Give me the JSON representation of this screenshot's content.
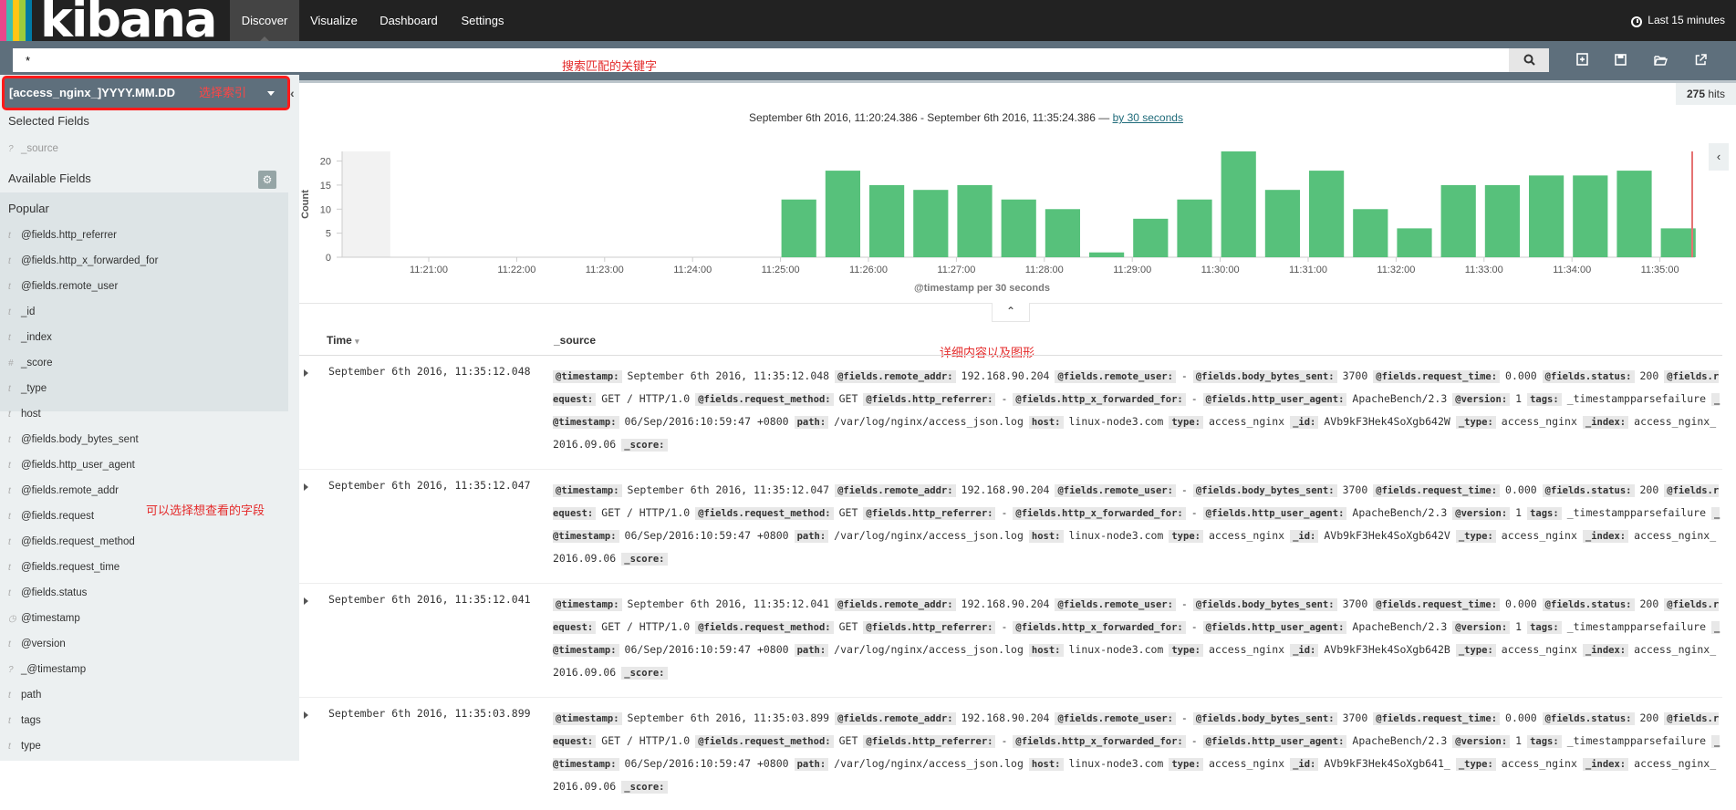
{
  "nav": {
    "logo": "kibana",
    "logo_colors": [
      "#e8478b",
      "#3ebeb0",
      "#fec514",
      "#9ccc3c",
      "#0079a5"
    ],
    "tabs": [
      {
        "label": "Discover",
        "active": true
      },
      {
        "label": "Visualize",
        "active": false
      },
      {
        "label": "Dashboard",
        "active": false
      },
      {
        "label": "Settings",
        "active": false
      }
    ],
    "timepicker": "Last 15 minutes"
  },
  "search": {
    "value": "*",
    "annotation": "搜索匹配的关键字"
  },
  "sidebar": {
    "index_pattern": "[access_nginx_]YYYY.MM.DD",
    "index_annotation": "选择索引",
    "selected_title": "Selected Fields",
    "selected_fields": [
      {
        "type": "?",
        "name": "_source"
      }
    ],
    "available_title": "Available Fields",
    "popular_title": "Popular",
    "popular_fields": [
      {
        "type": "t",
        "name": "@fields.http_referrer"
      },
      {
        "type": "t",
        "name": "@fields.http_x_forwarded_for"
      },
      {
        "type": "t",
        "name": "@fields.remote_user"
      },
      {
        "type": "t",
        "name": "_id"
      },
      {
        "type": "t",
        "name": "_index"
      },
      {
        "type": "#",
        "name": "_score"
      },
      {
        "type": "t",
        "name": "_type"
      },
      {
        "type": "t",
        "name": "host"
      }
    ],
    "other_fields": [
      {
        "type": "t",
        "name": "@fields.body_bytes_sent"
      },
      {
        "type": "t",
        "name": "@fields.http_user_agent"
      },
      {
        "type": "t",
        "name": "@fields.remote_addr"
      },
      {
        "type": "t",
        "name": "@fields.request"
      },
      {
        "type": "t",
        "name": "@fields.request_method"
      },
      {
        "type": "t",
        "name": "@fields.request_time"
      },
      {
        "type": "t",
        "name": "@fields.status"
      },
      {
        "type": "◷",
        "name": "@timestamp"
      },
      {
        "type": "t",
        "name": "@version"
      },
      {
        "type": "?",
        "name": "_@timestamp"
      },
      {
        "type": "t",
        "name": "path"
      },
      {
        "type": "t",
        "name": "tags"
      },
      {
        "type": "t",
        "name": "type"
      }
    ],
    "fields_annotation": "可以选择想查看的字段"
  },
  "hits": {
    "count": "275",
    "label": "hits"
  },
  "time_range": {
    "text": "September 6th 2016, 11:20:24.386 - September 6th 2016, 11:35:24.386 —",
    "interval": "by 30 seconds"
  },
  "chart_data": {
    "type": "bar",
    "ylabel": "Count",
    "xlabel": "@timestamp per 30 seconds",
    "ylim": [
      0,
      22
    ],
    "yticks": [
      0,
      5,
      10,
      15,
      20
    ],
    "xticks": [
      "11:21:00",
      "11:22:00",
      "11:23:00",
      "11:24:00",
      "11:25:00",
      "11:26:00",
      "11:27:00",
      "11:28:00",
      "11:29:00",
      "11:30:00",
      "11:31:00",
      "11:32:00",
      "11:33:00",
      "11:34:00",
      "11:35:00"
    ],
    "categories": [
      "11:25:00",
      "11:25:30",
      "11:26:00",
      "11:26:30",
      "11:27:00",
      "11:27:30",
      "11:28:00",
      "11:28:30",
      "11:29:00",
      "11:29:30",
      "11:30:00",
      "11:30:30",
      "11:31:00",
      "11:31:30",
      "11:32:00",
      "11:32:30",
      "11:33:00",
      "11:33:30",
      "11:34:00",
      "11:34:30",
      "11:35:00"
    ],
    "values": [
      12,
      18,
      15,
      14,
      15,
      12,
      10,
      1,
      8,
      12,
      22,
      14,
      18,
      10,
      6,
      15,
      15,
      17,
      17,
      18,
      6
    ],
    "bar_color": "#57c17b"
  },
  "table": {
    "time_header": "Time",
    "source_header": "_source",
    "annotation": "详细内容以及图形",
    "rows": [
      {
        "time": "September 6th 2016, 11:35:12.048",
        "fields": [
          {
            "k": "@timestamp:",
            "v": "September 6th 2016, 11:35:12.048"
          },
          {
            "k": "@fields.remote_addr:",
            "v": "192.168.90.204"
          },
          {
            "k": "@fields.remote_user:",
            "v": "-"
          },
          {
            "k": "@fields.body_bytes_sent:",
            "v": "3700"
          },
          {
            "k": "@fields.request_time:",
            "v": "0.000"
          },
          {
            "k": "@fields.status:",
            "v": "200"
          },
          {
            "k": "@fields.request:",
            "v": "GET / HTTP/1.0"
          },
          {
            "k": "@fields.request_method:",
            "v": "GET"
          },
          {
            "k": "@fields.http_referrer:",
            "v": "-"
          },
          {
            "k": "@fields.http_x_forwarded_for:",
            "v": "-"
          },
          {
            "k": "@fields.http_user_agent:",
            "v": "ApacheBench/2.3"
          },
          {
            "k": "@version:",
            "v": "1"
          },
          {
            "k": "tags:",
            "v": "_timestampparsefailure"
          },
          {
            "k": "_@timestamp:",
            "v": "06/Sep/2016:10:59:47 +0800"
          },
          {
            "k": "path:",
            "v": "/var/log/nginx/access_json.log"
          },
          {
            "k": "host:",
            "v": "linux-node3.com"
          },
          {
            "k": "type:",
            "v": "access_nginx"
          },
          {
            "k": "_id:",
            "v": "AVb9kF3Hek4SoXgb642W"
          },
          {
            "k": "_type:",
            "v": "access_nginx"
          },
          {
            "k": "_index:",
            "v": "access_nginx_2016.09.06"
          },
          {
            "k": "_score:",
            "v": ""
          }
        ]
      },
      {
        "time": "September 6th 2016, 11:35:12.047",
        "fields": [
          {
            "k": "@timestamp:",
            "v": "September 6th 2016, 11:35:12.047"
          },
          {
            "k": "@fields.remote_addr:",
            "v": "192.168.90.204"
          },
          {
            "k": "@fields.remote_user:",
            "v": "-"
          },
          {
            "k": "@fields.body_bytes_sent:",
            "v": "3700"
          },
          {
            "k": "@fields.request_time:",
            "v": "0.000"
          },
          {
            "k": "@fields.status:",
            "v": "200"
          },
          {
            "k": "@fields.request:",
            "v": "GET / HTTP/1.0"
          },
          {
            "k": "@fields.request_method:",
            "v": "GET"
          },
          {
            "k": "@fields.http_referrer:",
            "v": "-"
          },
          {
            "k": "@fields.http_x_forwarded_for:",
            "v": "-"
          },
          {
            "k": "@fields.http_user_agent:",
            "v": "ApacheBench/2.3"
          },
          {
            "k": "@version:",
            "v": "1"
          },
          {
            "k": "tags:",
            "v": "_timestampparsefailure"
          },
          {
            "k": "_@timestamp:",
            "v": "06/Sep/2016:10:59:47 +0800"
          },
          {
            "k": "path:",
            "v": "/var/log/nginx/access_json.log"
          },
          {
            "k": "host:",
            "v": "linux-node3.com"
          },
          {
            "k": "type:",
            "v": "access_nginx"
          },
          {
            "k": "_id:",
            "v": "AVb9kF3Hek4SoXgb642V"
          },
          {
            "k": "_type:",
            "v": "access_nginx"
          },
          {
            "k": "_index:",
            "v": "access_nginx_2016.09.06"
          },
          {
            "k": "_score:",
            "v": ""
          }
        ]
      },
      {
        "time": "September 6th 2016, 11:35:12.041",
        "fields": [
          {
            "k": "@timestamp:",
            "v": "September 6th 2016, 11:35:12.041"
          },
          {
            "k": "@fields.remote_addr:",
            "v": "192.168.90.204"
          },
          {
            "k": "@fields.remote_user:",
            "v": "-"
          },
          {
            "k": "@fields.body_bytes_sent:",
            "v": "3700"
          },
          {
            "k": "@fields.request_time:",
            "v": "0.000"
          },
          {
            "k": "@fields.status:",
            "v": "200"
          },
          {
            "k": "@fields.request:",
            "v": "GET / HTTP/1.0"
          },
          {
            "k": "@fields.request_method:",
            "v": "GET"
          },
          {
            "k": "@fields.http_referrer:",
            "v": "-"
          },
          {
            "k": "@fields.http_x_forwarded_for:",
            "v": "-"
          },
          {
            "k": "@fields.http_user_agent:",
            "v": "ApacheBench/2.3"
          },
          {
            "k": "@version:",
            "v": "1"
          },
          {
            "k": "tags:",
            "v": "_timestampparsefailure"
          },
          {
            "k": "_@timestamp:",
            "v": "06/Sep/2016:10:59:47 +0800"
          },
          {
            "k": "path:",
            "v": "/var/log/nginx/access_json.log"
          },
          {
            "k": "host:",
            "v": "linux-node3.com"
          },
          {
            "k": "type:",
            "v": "access_nginx"
          },
          {
            "k": "_id:",
            "v": "AVb9kF3Hek4SoXgb642B"
          },
          {
            "k": "_type:",
            "v": "access_nginx"
          },
          {
            "k": "_index:",
            "v": "access_nginx_2016.09.06"
          },
          {
            "k": "_score:",
            "v": ""
          }
        ]
      },
      {
        "time": "September 6th 2016, 11:35:03.899",
        "fields": [
          {
            "k": "@timestamp:",
            "v": "September 6th 2016, 11:35:03.899"
          },
          {
            "k": "@fields.remote_addr:",
            "v": "192.168.90.204"
          },
          {
            "k": "@fields.remote_user:",
            "v": "-"
          },
          {
            "k": "@fields.body_bytes_sent:",
            "v": "3700"
          },
          {
            "k": "@fields.request_time:",
            "v": "0.000"
          },
          {
            "k": "@fields.status:",
            "v": "200"
          },
          {
            "k": "@fields.request:",
            "v": "GET / HTTP/1.0"
          },
          {
            "k": "@fields.request_method:",
            "v": "GET"
          },
          {
            "k": "@fields.http_referrer:",
            "v": "-"
          },
          {
            "k": "@fields.http_x_forwarded_for:",
            "v": "-"
          },
          {
            "k": "@fields.http_user_agent:",
            "v": "ApacheBench/2.3"
          },
          {
            "k": "@version:",
            "v": "1"
          },
          {
            "k": "tags:",
            "v": "_timestampparsefailure"
          },
          {
            "k": "_@timestamp:",
            "v": "06/Sep/2016:10:59:47 +0800"
          },
          {
            "k": "path:",
            "v": "/var/log/nginx/access_json.log"
          },
          {
            "k": "host:",
            "v": "linux-node3.com"
          },
          {
            "k": "type:",
            "v": "access_nginx"
          },
          {
            "k": "_id:",
            "v": "AVb9kF3Hek4SoXgb641_"
          },
          {
            "k": "_type:",
            "v": "access_nginx"
          },
          {
            "k": "_index:",
            "v": "access_nginx_2016.09.06"
          },
          {
            "k": "_score:",
            "v": ""
          }
        ]
      }
    ]
  }
}
